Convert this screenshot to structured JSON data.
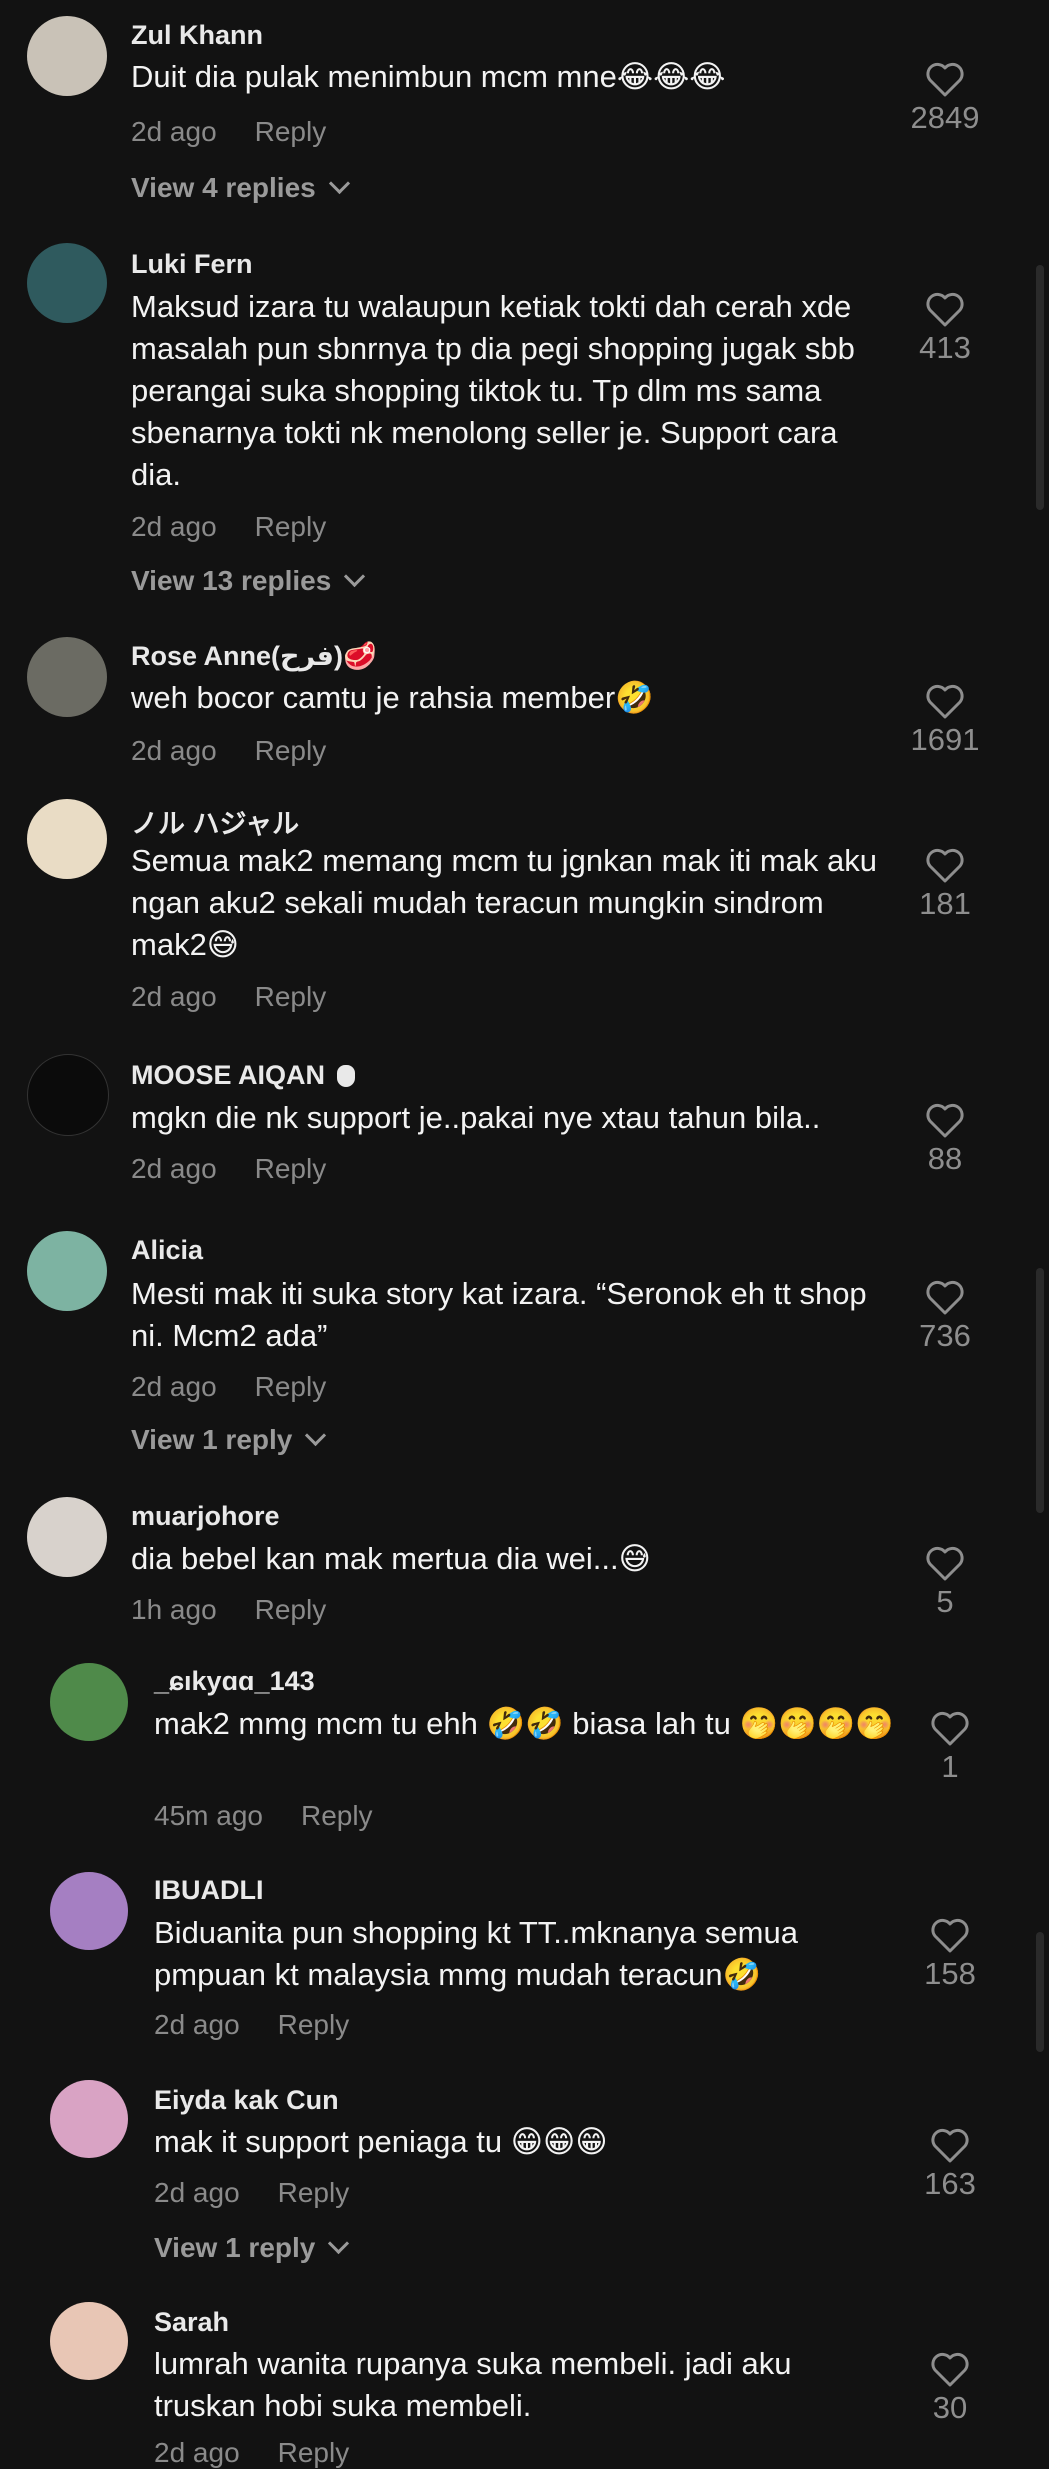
{
  "comments": [
    {
      "user": "Zul Khann",
      "text": "Duit dia pulak menimbun mcm mne😂😂😂",
      "time": "2d ago",
      "reply": "Reply",
      "likes": "2849",
      "view": "View 4 replies",
      "avatar_color": "#c9c2b7"
    },
    {
      "user": "Luki Fern",
      "text": "Maksud izara tu walaupun ketiak tokti dah cerah xde masalah pun sbnrnya tp dia pegi shopping jugak sbb perangai suka shopping tiktok tu. Tp dlm ms sama sbenarnya tokti nk menolong seller je. Support cara dia.",
      "time": "2d ago",
      "reply": "Reply",
      "likes": "413",
      "view": "View 13 replies",
      "avatar_color": "#2f5a5e"
    },
    {
      "user": "Rose Anne(فرح)🥩",
      "text": "weh bocor camtu je rahsia member🤣",
      "time": "2d ago",
      "reply": "Reply",
      "likes": "1691",
      "avatar_color": "#6b6b63"
    },
    {
      "user": "ノル ハジャル",
      "text": "Semua mak2 memang mcm tu jgnkan mak iti mak aku ngan aku2 sekali mudah teracun mungkin sindrom mak2😅",
      "time": "2d ago",
      "reply": "Reply",
      "likes": "181",
      "avatar_color": "#e9dcc5"
    },
    {
      "user": "MOOSE AIQAN ",
      "text": "mgkn die nk support je..pakai nye xtau tahun bila..",
      "time": "2d ago",
      "reply": "Reply",
      "likes": "88",
      "avatar_color": "#0b0b0b"
    },
    {
      "user": "Alicia",
      "text": "Mesti mak iti suka story kat izara. “Seronok eh tt shop ni. Mcm2 ada”",
      "time": "2d ago",
      "reply": "Reply",
      "likes": "736",
      "view": "View 1 reply",
      "avatar_color": "#7db3a2"
    },
    {
      "user": "muarjohore",
      "text": "dia bebel kan mak mertua dia wei...😅",
      "time": "1h ago",
      "reply": "Reply",
      "likes": "5",
      "avatar_color": "#d8d2cc"
    },
    {
      "user": "_ɕıkyɑɑ_143",
      "text": "mak2 mmg mcm tu ehh 🤣🤣 biasa lah tu 🤭🤭🤭🤭",
      "time": "45m ago",
      "reply": "Reply",
      "likes": "1",
      "avatar_color": "#4f8a4a"
    },
    {
      "user": "IBUADLI",
      "text": "Biduanita pun shopping kt TT..mknanya semua pmpuan kt malaysia mmg mudah teracun🤣",
      "time": "2d ago",
      "reply": "Reply",
      "likes": "158",
      "avatar_color": "#a57fc2"
    },
    {
      "user": "Eiyda kak Cun",
      "text": "mak it support peniaga tu 😁😁😁",
      "time": "2d ago",
      "reply": "Reply",
      "likes": "163",
      "view": "View 1 reply",
      "avatar_color": "#d9a3c4"
    },
    {
      "user": "Sarah",
      "text": "lumrah wanita rupanya suka membeli. jadi aku truskan hobi suka membeli.",
      "time": "2d ago",
      "reply": "Reply",
      "likes": "30",
      "avatar_color": "#e8c6b5"
    }
  ],
  "colors": {
    "background": "#121212",
    "text": "#f3f3f3",
    "muted": "#8a8a8a"
  }
}
